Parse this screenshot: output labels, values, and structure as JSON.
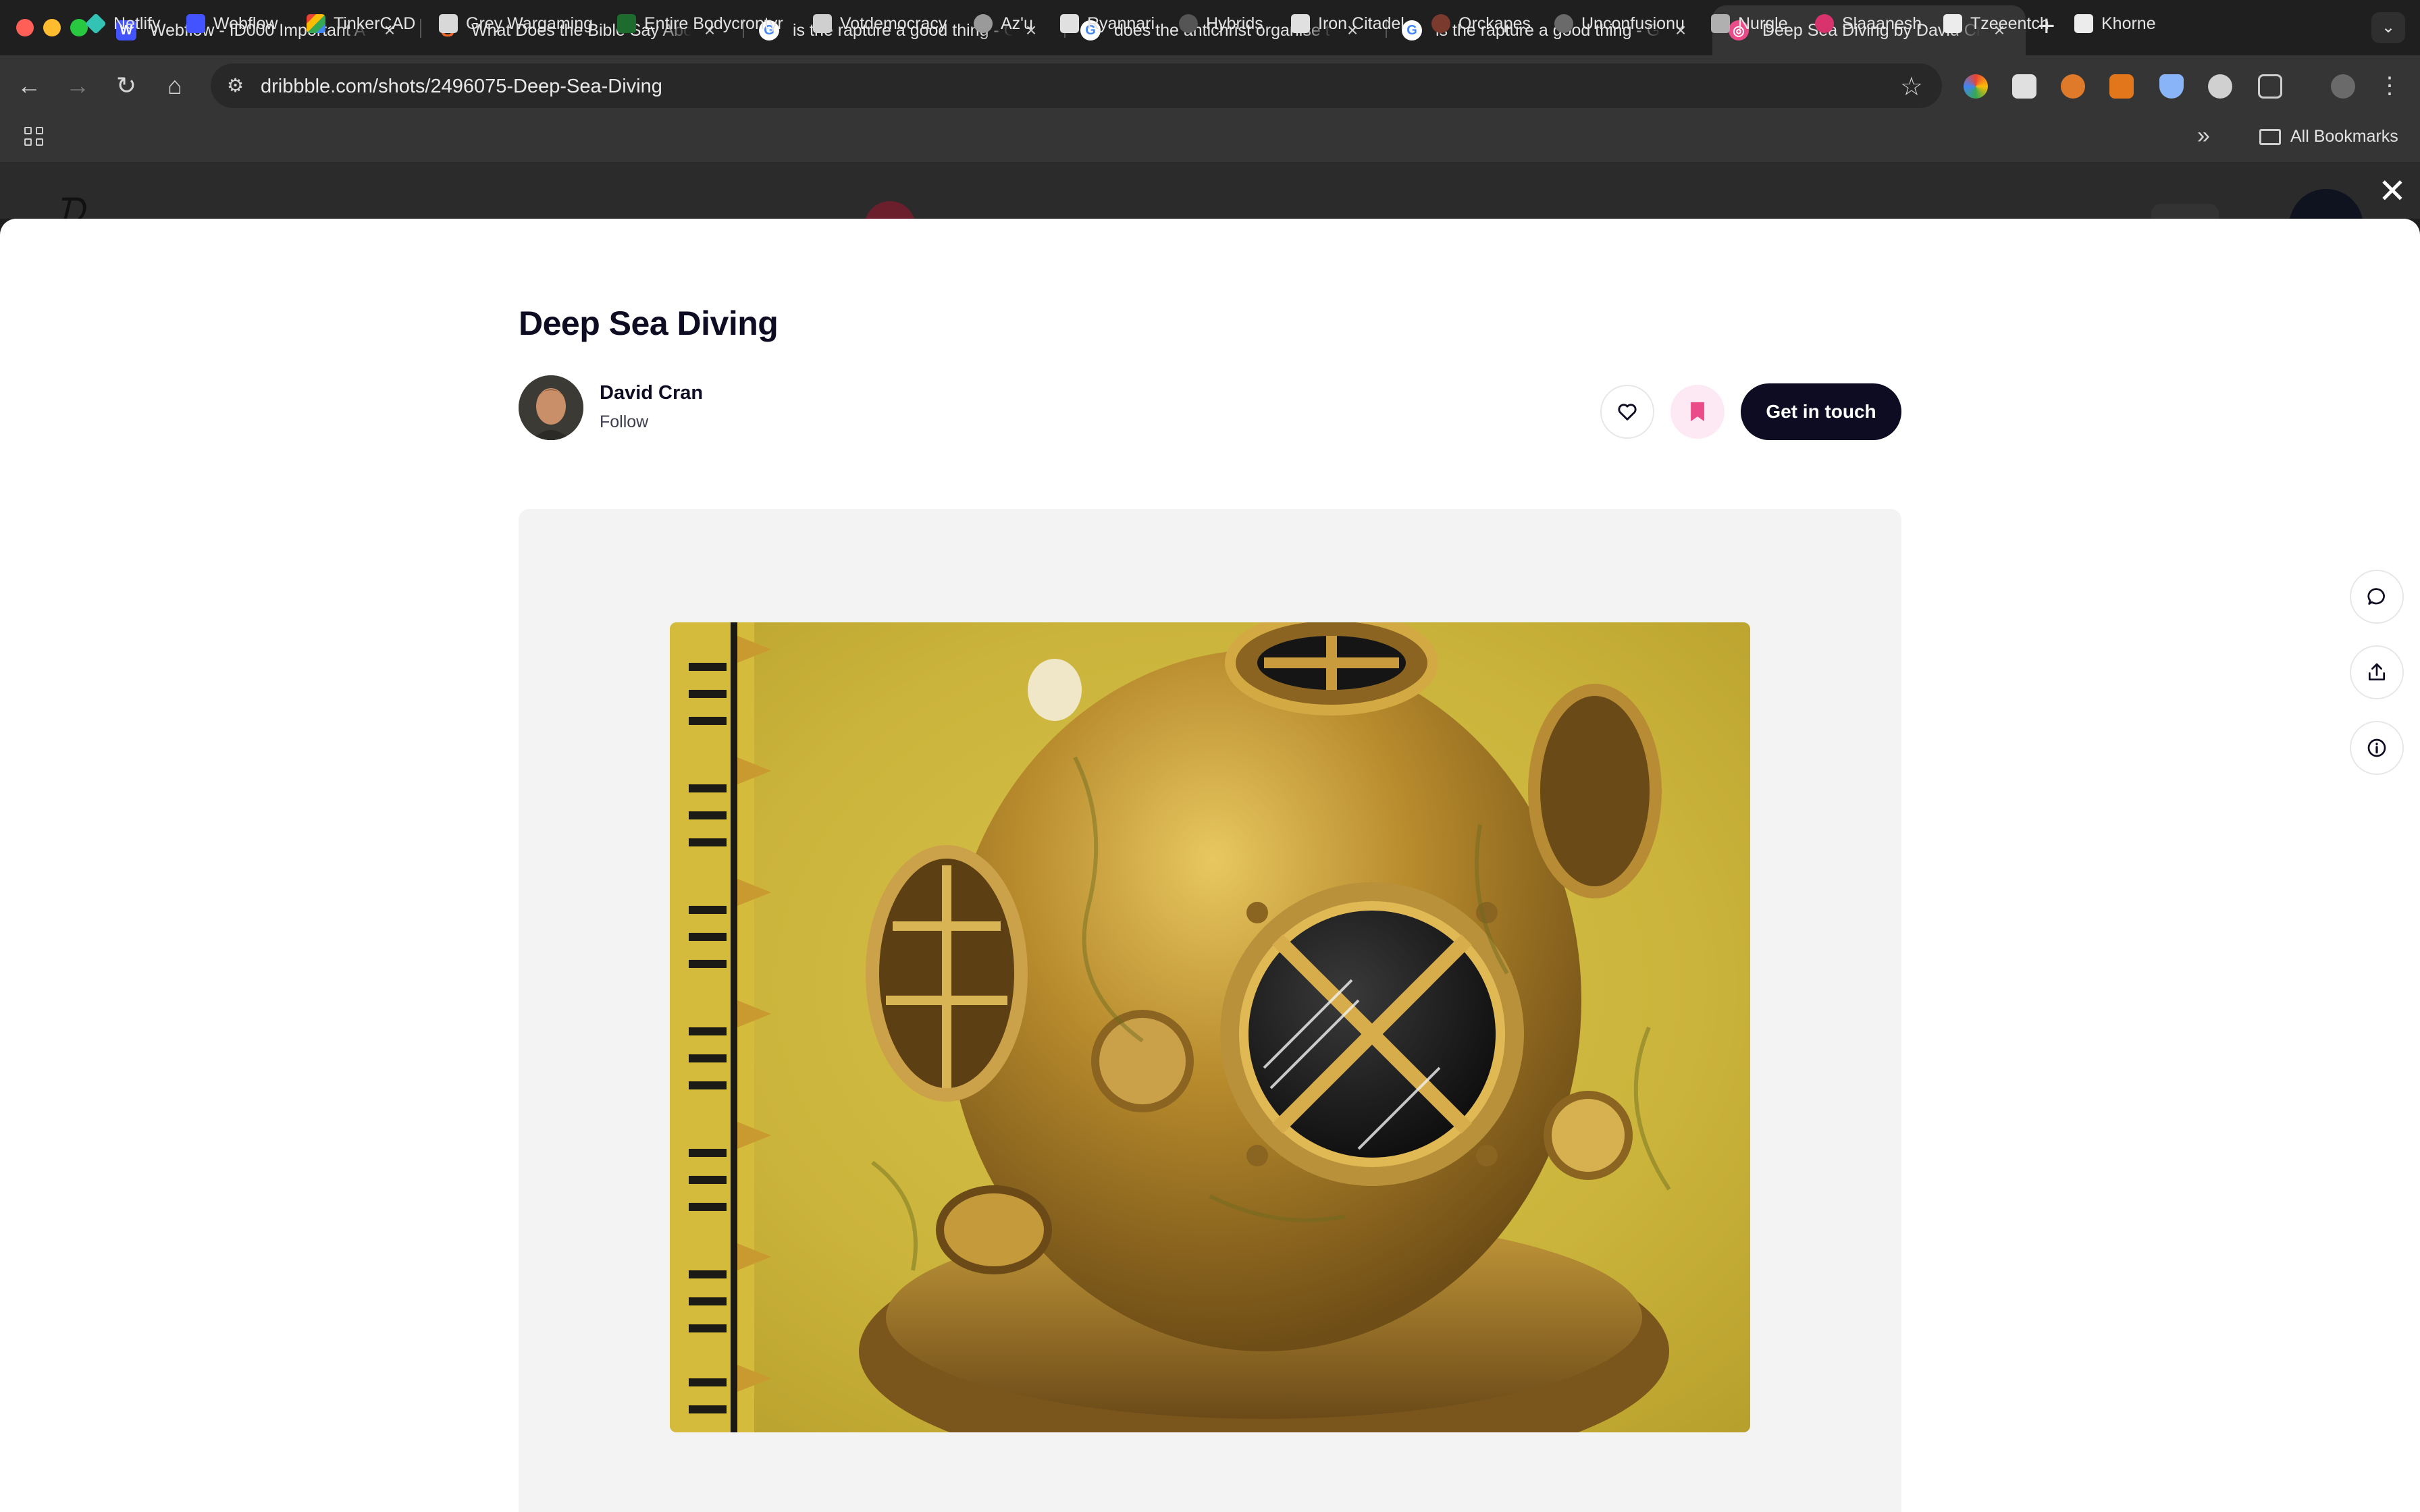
{
  "browser": {
    "tabs": [
      {
        "title": "Webflow - ID000 Important A",
        "favicon": "webflow-icon",
        "color": "#4353ff",
        "glyph": "W"
      },
      {
        "title": "What Does the Bible Say Abo",
        "favicon": "s-icon",
        "color": "#f0692b",
        "glyph": "S"
      },
      {
        "title": "is the rapture a good thing - G",
        "favicon": "google-icon",
        "color": "#ffffff",
        "glyph": "G"
      },
      {
        "title": "does the antichrist organise t",
        "favicon": "google-icon",
        "color": "#ffffff",
        "glyph": "G"
      },
      {
        "title": "is the rapture a good thing - G",
        "favicon": "google-icon",
        "color": "#ffffff",
        "glyph": "G"
      },
      {
        "title": "Deep Sea Diving by David Cra",
        "favicon": "dribbble-icon",
        "color": "#ea4c89",
        "glyph": "◎"
      }
    ],
    "address": "dribbble.com/shots/2496075-Deep-Sea-Diving",
    "bookmarks": [
      {
        "label": "Netlify",
        "color": "#32c3b4"
      },
      {
        "label": "Webflow",
        "color": "#4353ff"
      },
      {
        "label": "TinkerCAD",
        "color": "#e8a33b"
      },
      {
        "label": "Grey Wargaming",
        "color": "#d8d8d8"
      },
      {
        "label": "Entire Bodycrontyr",
        "color": "#1e6b2e"
      },
      {
        "label": "Votdemocracy",
        "color": "#cfcfcf"
      },
      {
        "label": "Az'u",
        "color": "#9a9a9a"
      },
      {
        "label": "Ryannari",
        "color": "#e0e0e0"
      },
      {
        "label": "Hybrids",
        "color": "#555555"
      },
      {
        "label": "Iron Citadel",
        "color": "#e0e0e0"
      },
      {
        "label": "Orckapes",
        "color": "#7a3b2e"
      },
      {
        "label": "Unconfusionu",
        "color": "#6a6a6a"
      },
      {
        "label": "Nurgle",
        "color": "#b0b0b0"
      },
      {
        "label": "Slaaanesh",
        "color": "#d9336e"
      },
      {
        "label": "Tzeeentch",
        "color": "#ececec"
      },
      {
        "label": "Khorne",
        "color": "#ececec"
      }
    ],
    "all_bookmarks": "All Bookmarks",
    "overflow": "»"
  },
  "shot": {
    "title": "Deep Sea Diving",
    "author": "David Cran",
    "follow": "Follow",
    "cta": "Get in touch"
  },
  "colors": {
    "accent": "#0d0c22",
    "save_bg": "#fde9f4",
    "save_icon": "#ea4c89"
  }
}
